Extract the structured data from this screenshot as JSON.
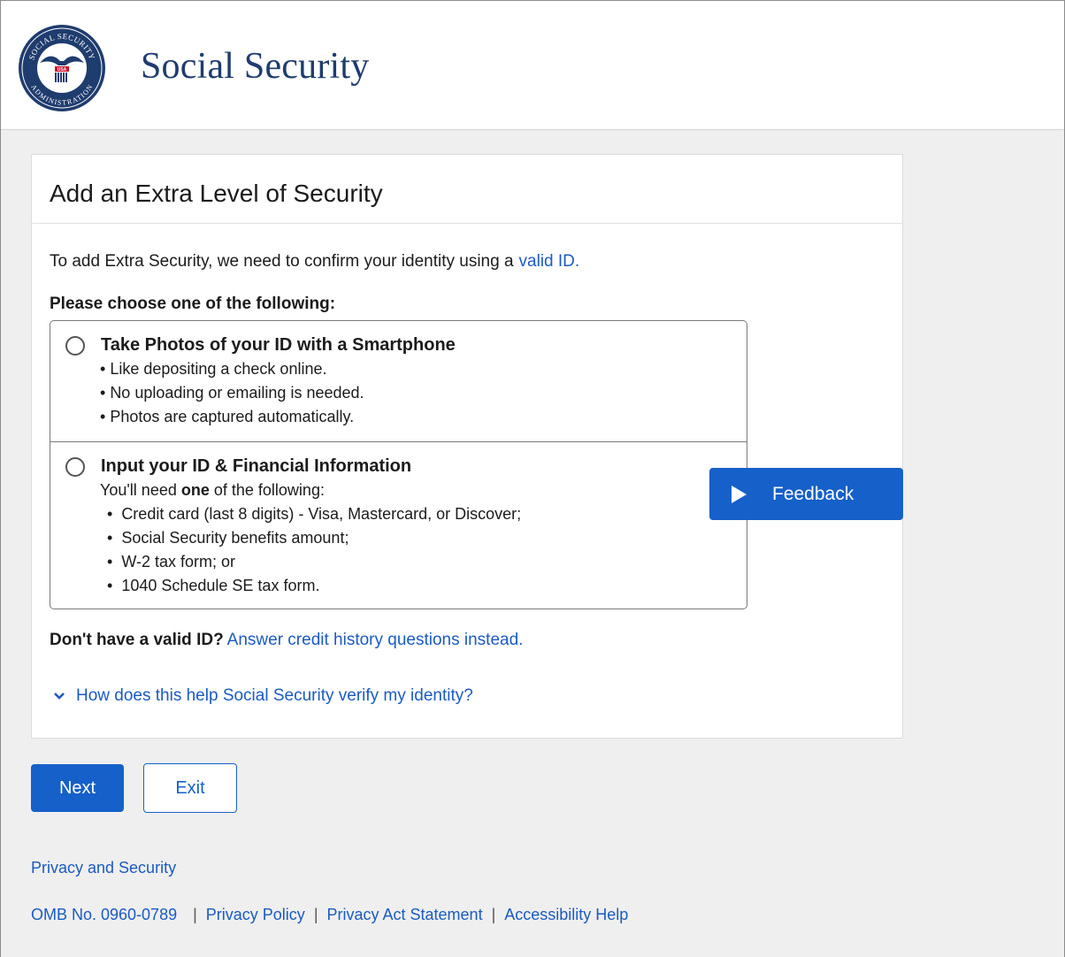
{
  "header": {
    "brand": "Social Security",
    "seal": {
      "top_text": "SOCIAL SECURITY",
      "bottom_text": "ADMINISTRATION",
      "center_text": "USA"
    }
  },
  "card": {
    "title": "Add an Extra Level of Security",
    "intro_text": "To add Extra Security, we need to confirm your identity using a",
    "intro_link": "valid ID.",
    "choose_label": "Please choose one of the following:",
    "options": [
      {
        "title": "Take Photos of your ID with a Smartphone",
        "bullets": [
          "Like depositing a check online.",
          "No uploading or emailing is needed.",
          "Photos are captured automatically."
        ]
      },
      {
        "title": "Input your ID & Financial Information",
        "need_prefix": "You'll need ",
        "need_bold": "one",
        "need_suffix": " of the following:",
        "bullets": [
          "Credit card (last 8 digits) - Visa, Mastercard, or Discover;",
          "Social Security benefits amount;",
          "W-2 tax form; or",
          "1040 Schedule SE tax form."
        ]
      }
    ],
    "no_id_label": "Don't have a valid ID?",
    "no_id_link": "Answer credit history questions instead.",
    "how_link": "How does this help Social Security verify my identity?"
  },
  "feedback_label": "Feedback",
  "buttons": {
    "next": "Next",
    "exit": "Exit"
  },
  "privacy_security": "Privacy and Security",
  "footer": {
    "omb": "OMB No. 0960-0789",
    "links": [
      "Privacy Policy",
      "Privacy Act Statement",
      "Accessibility Help"
    ]
  },
  "colors": {
    "brand_navy": "#1f3c6e",
    "primary_blue": "#1560c9",
    "link_blue": "#1a5bc4"
  }
}
